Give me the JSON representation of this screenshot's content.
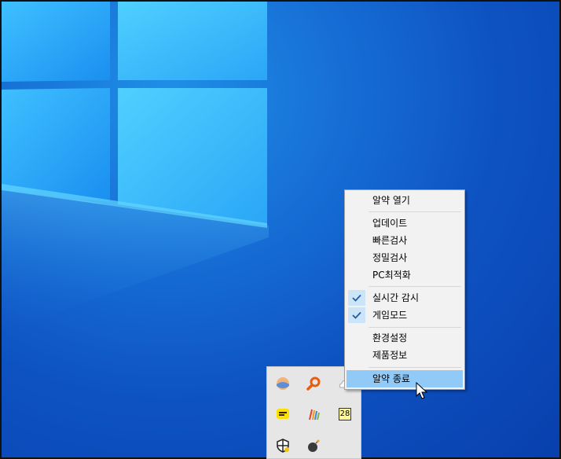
{
  "context_menu": {
    "items": [
      {
        "label": "알약 열기",
        "checked": false,
        "highlighted": false
      },
      {
        "label": "업데이트",
        "checked": false,
        "highlighted": false
      },
      {
        "label": "빠른검사",
        "checked": false,
        "highlighted": false
      },
      {
        "label": "정밀검사",
        "checked": false,
        "highlighted": false
      },
      {
        "label": "PC최적화",
        "checked": false,
        "highlighted": false
      },
      {
        "label": "실시간 감시",
        "checked": true,
        "highlighted": false
      },
      {
        "label": "게임모드",
        "checked": true,
        "highlighted": false
      },
      {
        "label": "환경설정",
        "checked": false,
        "highlighted": false
      },
      {
        "label": "제품정보",
        "checked": false,
        "highlighted": false
      },
      {
        "label": "알약 종료",
        "checked": false,
        "highlighted": true
      }
    ]
  },
  "tray_flyout": {
    "icons": [
      {
        "name": "weather-app-icon"
      },
      {
        "name": "search-magnifier-icon"
      },
      {
        "name": "cloud-icon"
      },
      {
        "name": "kakaotalk-icon"
      },
      {
        "name": "stripes-app-icon"
      },
      {
        "name": "calendar-icon",
        "text": "28"
      },
      {
        "name": "security-shield-icon"
      },
      {
        "name": "bomb-icon"
      }
    ]
  },
  "colors": {
    "menu_bg": "#f2f2f2",
    "menu_highlight": "#91c9f7",
    "check_bg": "#cce4f7",
    "check_mark": "#1a5fa8"
  }
}
